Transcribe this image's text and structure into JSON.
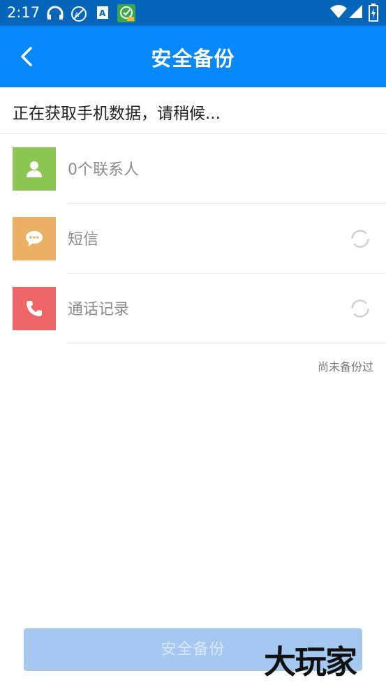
{
  "status_bar": {
    "time": "2:17",
    "left_icons": [
      "headset-icon",
      "no-sync-icon",
      "font-a-icon",
      "app-badge-icon"
    ],
    "right_icons": [
      "wifi-icon",
      "signal-icon",
      "battery-charging-icon"
    ]
  },
  "app_bar": {
    "title": "安全备份",
    "back_icon": "chevron-left-icon"
  },
  "loading_text": "正在获取手机数据，请稍候...",
  "items": [
    {
      "label": "0个联系人",
      "icon": "person-icon",
      "color": "#8bc653",
      "loading": false
    },
    {
      "label": "短信",
      "icon": "chat-bubble-icon",
      "color": "#ebb066",
      "loading": true
    },
    {
      "label": "通话记录",
      "icon": "phone-icon",
      "color": "#ee6668",
      "loading": true
    }
  ],
  "backup_status": "尚未备份过",
  "backup_button": {
    "label": "安全备份",
    "enabled": false
  },
  "watermark": "大玩家",
  "colors": {
    "status_bar": "#0565b9",
    "app_bar": "#0889fb",
    "button_disabled": "#a5c8f1"
  }
}
